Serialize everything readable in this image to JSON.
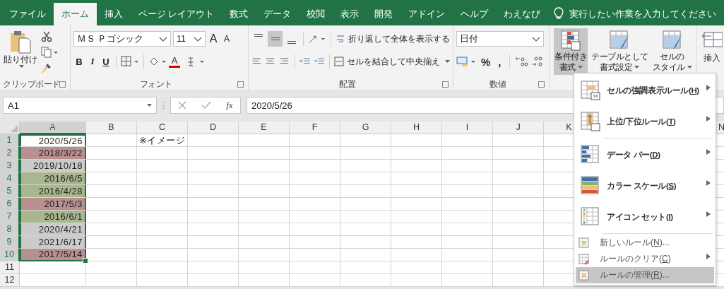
{
  "tabs": [
    {
      "label": "ファイル",
      "selected": false
    },
    {
      "label": "ホーム",
      "selected": true
    },
    {
      "label": "挿入",
      "selected": false
    },
    {
      "label": "ページ レイアウト",
      "selected": false
    },
    {
      "label": "数式",
      "selected": false
    },
    {
      "label": "データ",
      "selected": false
    },
    {
      "label": "校閲",
      "selected": false
    },
    {
      "label": "表示",
      "selected": false
    },
    {
      "label": "開発",
      "selected": false
    },
    {
      "label": "アドイン",
      "selected": false
    },
    {
      "label": "ヘルプ",
      "selected": false
    },
    {
      "label": "わえなび",
      "selected": false
    }
  ],
  "tell_me": "実行したい作業を入力してください",
  "ribbon": {
    "clipboard": {
      "label": "クリップボード",
      "paste": "貼り付け"
    },
    "font": {
      "label": "フォント",
      "font_name": "ＭＳ Ｐゴシック",
      "font_size": "11",
      "grow": "A",
      "shrink": "A",
      "bold": "B",
      "italic": "I",
      "underline": "U",
      "font_color": "A"
    },
    "alignment": {
      "label": "配置",
      "vertical": [
        {
          "selected": false
        },
        {
          "selected": true
        },
        {
          "selected": false
        }
      ],
      "wrap_text": "折り返して全体を表示する",
      "merge": "セルを結合して中央揃え"
    },
    "number": {
      "label": "数値",
      "format": "日付",
      "percent": "%",
      "comma": ","
    },
    "styles": [
      {
        "lines": [
          "条件付き",
          "書式"
        ],
        "selected": true
      },
      {
        "lines": [
          "テーブルとして",
          "書式設定"
        ],
        "selected": false
      },
      {
        "lines": [
          "セルの",
          "スタイル"
        ],
        "selected": false
      }
    ],
    "cells": {
      "insert": "挿入"
    }
  },
  "formula_bar": {
    "name_box": "A1",
    "fx": "fx",
    "value": "2020/5/26"
  },
  "columns": [
    {
      "label": "A",
      "selected": true
    },
    {
      "label": "B",
      "selected": false
    },
    {
      "label": "C",
      "selected": false
    },
    {
      "label": "D",
      "selected": false
    },
    {
      "label": "E",
      "selected": false
    },
    {
      "label": "F",
      "selected": false
    },
    {
      "label": "G",
      "selected": false
    },
    {
      "label": "H",
      "selected": false
    },
    {
      "label": "I",
      "selected": false
    },
    {
      "label": "J",
      "selected": false
    },
    {
      "label": "K",
      "selected": false
    },
    {},
    {},
    {
      "label": "N",
      "selected": false
    }
  ],
  "rows": [
    {
      "header": "1",
      "selected": true,
      "cells": [
        {
          "kind": "date",
          "value": "2020/5/26",
          "color": "#ffffff"
        },
        {},
        {
          "kind": "text",
          "value": "※イメージ"
        }
      ]
    },
    {
      "header": "2",
      "selected": true,
      "cells": [
        {
          "kind": "date",
          "value": "2018/3/22",
          "color": "#b98f8f"
        }
      ]
    },
    {
      "header": "3",
      "selected": true,
      "cells": [
        {
          "kind": "date",
          "value": "2019/10/18",
          "color": "#cbcbcb"
        }
      ]
    },
    {
      "header": "4",
      "selected": true,
      "cells": [
        {
          "kind": "date",
          "value": "2016/6/5",
          "color": "#a9b78f"
        }
      ]
    },
    {
      "header": "5",
      "selected": true,
      "cells": [
        {
          "kind": "date",
          "value": "2016/4/28",
          "color": "#a9b78f"
        }
      ]
    },
    {
      "header": "6",
      "selected": true,
      "cells": [
        {
          "kind": "date",
          "value": "2017/5/3",
          "color": "#b98f8f"
        }
      ]
    },
    {
      "header": "7",
      "selected": true,
      "cells": [
        {
          "kind": "date",
          "value": "2016/6/1",
          "color": "#a9b78f"
        }
      ]
    },
    {
      "header": "8",
      "selected": true,
      "cells": [
        {
          "kind": "date",
          "value": "2020/4/21",
          "color": "#cbcbcb"
        }
      ]
    },
    {
      "header": "9",
      "selected": true,
      "cells": [
        {
          "kind": "date",
          "value": "2021/6/17",
          "color": "#cbcbcb"
        }
      ]
    },
    {
      "header": "10",
      "selected": true,
      "cells": [
        {
          "kind": "date",
          "value": "2017/5/14",
          "color": "#b98f8f"
        }
      ]
    },
    {
      "header": "11",
      "selected": false
    },
    {
      "header": "12",
      "selected": false
    }
  ],
  "menu": [
    {
      "kind": "large",
      "prefix": "セルの強調表示ルール(",
      "key": "H",
      "suffix": ")",
      "submenu": true,
      "selected": false
    },
    {
      "kind": "large",
      "prefix": "上位/下位ルール(",
      "key": "T",
      "suffix": ")",
      "submenu": true,
      "selected": false
    },
    {
      "kind": "large",
      "prefix": "データ バー(",
      "key": "D",
      "suffix": ")",
      "submenu": true,
      "selected": false
    },
    {
      "kind": "large",
      "prefix": "カラー スケール(",
      "key": "S",
      "suffix": ")",
      "submenu": true,
      "selected": false
    },
    {
      "kind": "large",
      "prefix": "アイコン セット(",
      "key": "I",
      "suffix": ")",
      "submenu": true,
      "selected": false
    },
    {
      "kind": "small",
      "prefix": "新しいルール(",
      "key": "N",
      "suffix": ")...",
      "submenu": false,
      "selected": false
    },
    {
      "kind": "small",
      "prefix": "ルールのクリア(",
      "key": "C",
      "suffix": ")",
      "submenu": true,
      "selected": false
    },
    {
      "kind": "small",
      "prefix": "ルールの管理(",
      "key": "R",
      "suffix": ")...",
      "submenu": false,
      "selected": true
    }
  ]
}
